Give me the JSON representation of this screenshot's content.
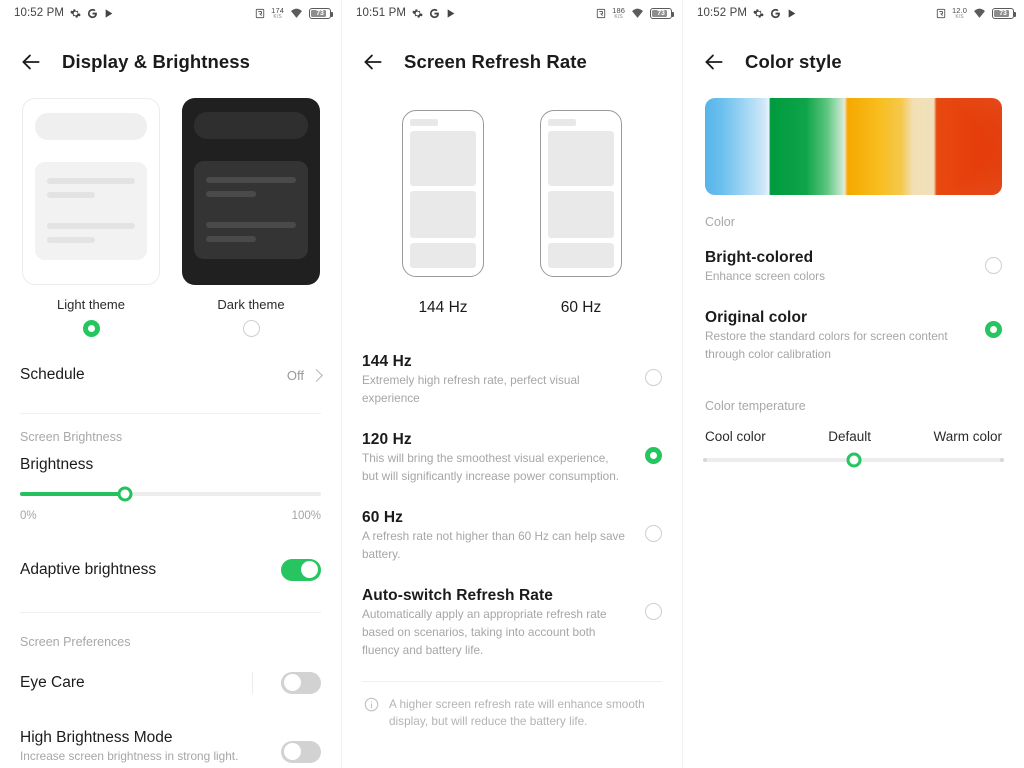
{
  "panels": [
    {
      "status": {
        "time": "10:52 PM",
        "net_rate": "174",
        "net_unit": "K/S",
        "battery": "73",
        "icons": [
          "settings-gear-icon",
          "google-icon",
          "play-icon",
          "nfc-icon",
          "wifi-icon",
          "battery-icon"
        ]
      },
      "title": "Display & Brightness",
      "themes": [
        {
          "label": "Light theme",
          "selected": true
        },
        {
          "label": "Dark theme",
          "selected": false
        }
      ],
      "schedule": {
        "label": "Schedule",
        "value": "Off"
      },
      "screen_brightness_label": "Screen Brightness",
      "brightness": {
        "label": "Brightness",
        "percent": 35,
        "min_label": "0%",
        "max_label": "100%"
      },
      "adaptive": {
        "label": "Adaptive brightness",
        "on": true
      },
      "screen_prefs_label": "Screen Preferences",
      "eye_care": {
        "label": "Eye Care",
        "on": false
      },
      "high_brightness": {
        "label": "High Brightness Mode",
        "desc": "Increase screen brightness in strong light.",
        "on": false
      }
    },
    {
      "status": {
        "time": "10:51 PM",
        "net_rate": "186",
        "net_unit": "K/S",
        "battery": "73"
      },
      "title": "Screen Refresh Rate",
      "previews": [
        {
          "label": "144 Hz"
        },
        {
          "label": "60 Hz"
        }
      ],
      "options": [
        {
          "title": "144 Hz",
          "desc": "Extremely high refresh rate, perfect visual experience",
          "selected": false
        },
        {
          "title": "120 Hz",
          "desc": "This will bring the smoothest visual experience, but will significantly increase power consumption.",
          "selected": true
        },
        {
          "title": "60 Hz",
          "desc": "A refresh rate not higher than 60 Hz can help save battery.",
          "selected": false
        },
        {
          "title": "Auto-switch Refresh Rate",
          "desc": "Automatically apply an appropriate refresh rate based on scenarios, taking into account both fluency and battery life.",
          "selected": false
        }
      ],
      "footnote": "A higher screen refresh rate will enhance smooth display, but will reduce the battery life."
    },
    {
      "status": {
        "time": "10:52 PM",
        "net_rate": "12.0",
        "net_unit": "K/S",
        "battery": "73"
      },
      "title": "Color style",
      "color_label": "Color",
      "color_options": [
        {
          "title": "Bright-colored",
          "desc": "Enhance screen colors",
          "selected": false
        },
        {
          "title": "Original color",
          "desc": "Restore the standard colors for screen content through color calibration",
          "selected": true
        }
      ],
      "temperature_label": "Color temperature",
      "temperature": {
        "cool": "Cool color",
        "default": "Default",
        "warm": "Warm color",
        "position_percent": 50
      }
    }
  ],
  "colors": {
    "accent_green": "#25c560",
    "toggle_off": "#d2d2d2",
    "text_primary": "#1b1b1b",
    "text_secondary": "#a6a6a6"
  }
}
